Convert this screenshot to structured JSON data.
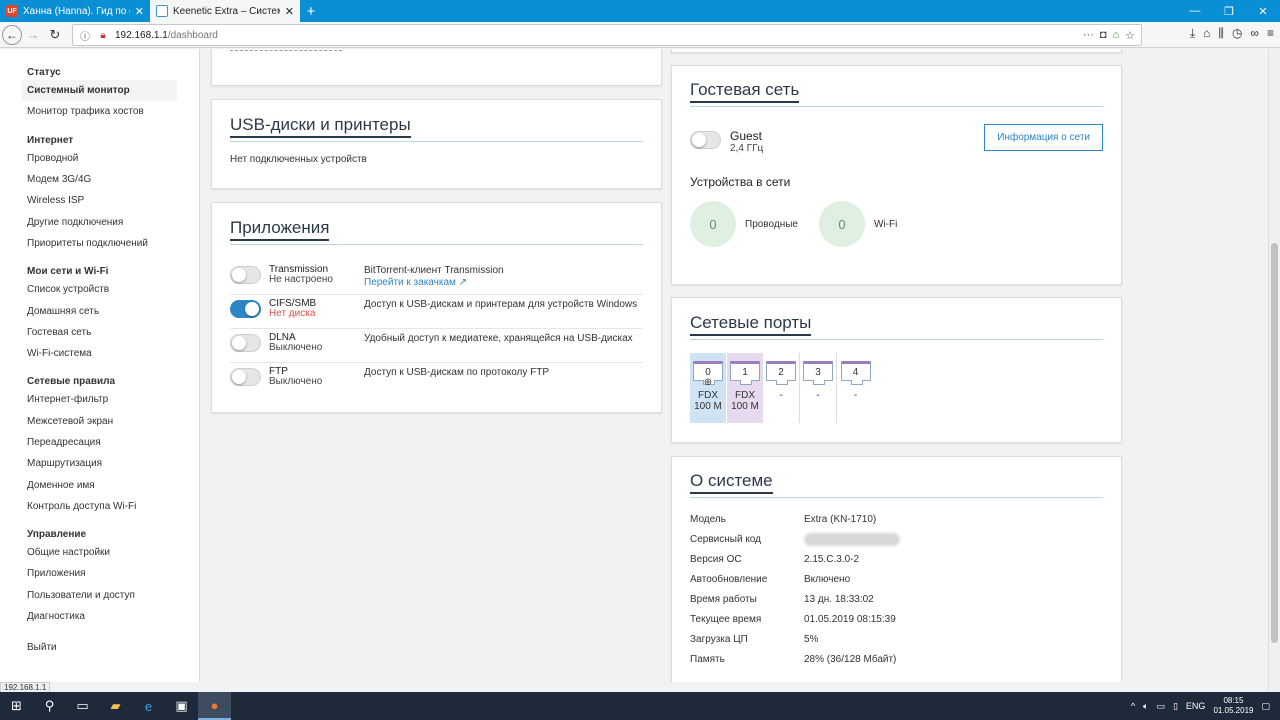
{
  "browser": {
    "tabs": [
      {
        "title": "Ханна (Hanna). Гид по сериа",
        "active": false
      },
      {
        "title": "Keenetic Extra – Системный м",
        "active": true
      }
    ],
    "url_host": "192.168.1.1",
    "url_path": "/dashboard",
    "status_url": "192.168.1.1"
  },
  "sidebar": {
    "groups": [
      {
        "head": "Статус",
        "items": [
          "Системный монитор",
          "Монитор трафика хостов"
        ]
      },
      {
        "head": "Интернет",
        "items": [
          "Проводной",
          "Модем 3G/4G",
          "Wireless ISP",
          "Другие подключения",
          "Приоритеты подключений"
        ]
      },
      {
        "head": "Мои сети и Wi-Fi",
        "items": [
          "Список устройств",
          "Домашняя сеть",
          "Гостевая сеть",
          "Wi-Fi-система"
        ]
      },
      {
        "head": "Сетевые правила",
        "items": [
          "Интернет-фильтр",
          "Межсетевой экран",
          "Переадресация",
          "Маршрутизация",
          "Доменное имя",
          "Контроль доступа Wi-Fi"
        ]
      },
      {
        "head": "Управление",
        "items": [
          "Общие настройки",
          "Приложения",
          "Пользователи и доступ",
          "Диагностика"
        ]
      }
    ],
    "logout": "Выйти"
  },
  "usb": {
    "title": "USB-диски и принтеры",
    "empty": "Нет подключенных устройств"
  },
  "apps": {
    "title": "Приложения",
    "rows": [
      {
        "name": "Transmission",
        "status": "Не настроено",
        "status_error": false,
        "on": false,
        "desc": "BitTorrent-клиент Transmission",
        "link": "Перейти к закачкам"
      },
      {
        "name": "CIFS/SMB",
        "status": "Нет диска",
        "status_error": true,
        "on": true,
        "desc": "Доступ к USB-дискам и принтерам для устройств Windows",
        "link": ""
      },
      {
        "name": "DLNA",
        "status": "Выключено",
        "status_error": false,
        "on": false,
        "desc": "Удобный доступ к медиатеке, хранящейся на USB-дисках",
        "link": ""
      },
      {
        "name": "FTP",
        "status": "Выключено",
        "status_error": false,
        "on": false,
        "desc": "Доступ к USB-дискам по протоколу FTP",
        "link": ""
      }
    ]
  },
  "guest": {
    "title": "Гостевая сеть",
    "network_name": "Guest",
    "band": "2,4 ГГц",
    "info_button": "Информация о сети",
    "devices_title": "Устройства в сети",
    "wired_count": "0",
    "wired_label": "Проводные",
    "wifi_count": "0",
    "wifi_label": "Wi-Fi"
  },
  "ports": {
    "title": "Сетевые порты",
    "items": [
      {
        "num": "0",
        "line1": "FDX",
        "line2": "100 M",
        "highlight": "#cfe3f5",
        "wan": true
      },
      {
        "num": "1",
        "line1": "FDX",
        "line2": "100 M",
        "highlight": "#e7d9ee",
        "wan": false
      },
      {
        "num": "2",
        "line1": "-",
        "line2": "",
        "highlight": "",
        "wan": false
      },
      {
        "num": "3",
        "line1": "-",
        "line2": "",
        "highlight": "",
        "wan": false
      },
      {
        "num": "4",
        "line1": "-",
        "line2": "",
        "highlight": "",
        "wan": false
      }
    ]
  },
  "system": {
    "title": "О системе",
    "rows": [
      {
        "k": "Модель",
        "v": "Extra (KN-1710)"
      },
      {
        "k": "Сервисный код",
        "v": ""
      },
      {
        "k": "Версия ОС",
        "v": "2.15.C.3.0-2"
      },
      {
        "k": "Автообновление",
        "v": "Включено"
      },
      {
        "k": "Время работы",
        "v": "13 дн. 18:33:02"
      },
      {
        "k": "Текущее время",
        "v": "01.05.2019 08:15:39"
      },
      {
        "k": "Загрузка ЦП",
        "v": "5%"
      },
      {
        "k": "Память",
        "v": "28% (36/128 Мбайт)"
      }
    ]
  },
  "taskbar": {
    "lang": "ENG",
    "time": "08:15",
    "date": "01.05.2019"
  }
}
